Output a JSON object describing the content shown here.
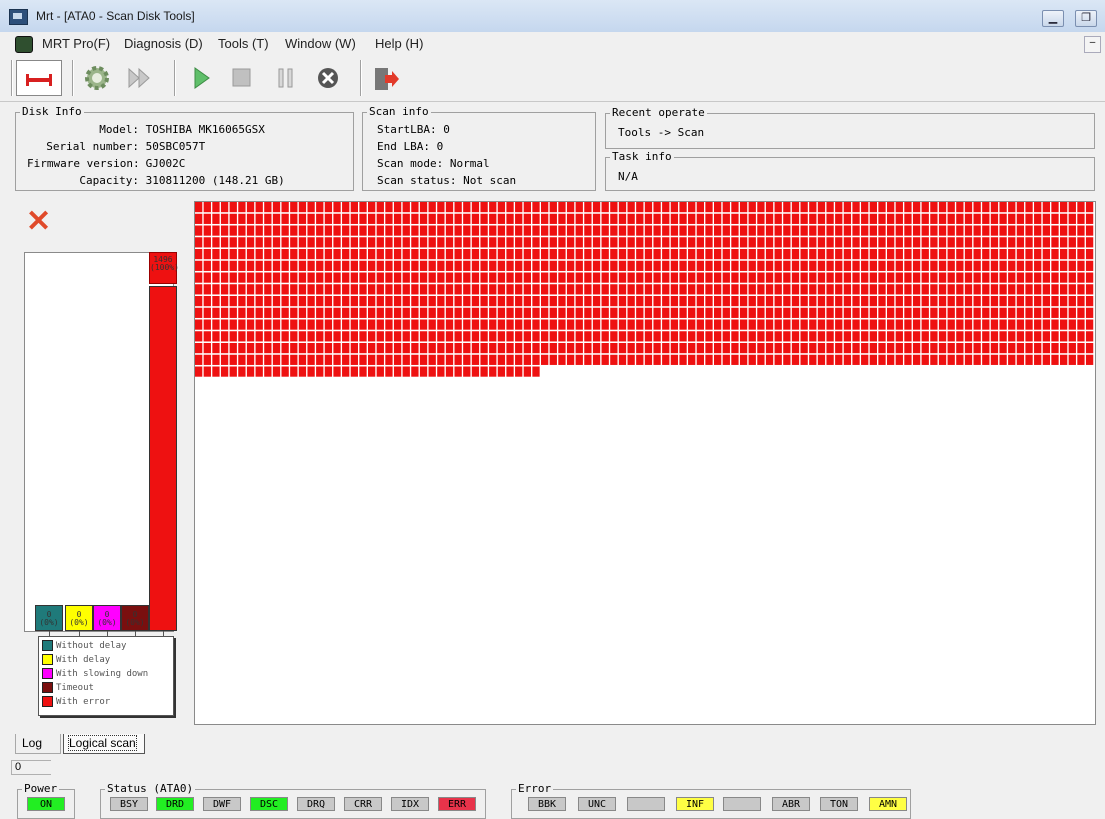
{
  "window": {
    "title": "Mrt - [ATA0 - Scan Disk Tools]"
  },
  "menu": {
    "items": [
      "MRT Pro(F)",
      "Diagnosis (D)",
      "Tools (T)",
      "Window (W)",
      "Help (H)"
    ]
  },
  "toolbar": {
    "buttons": [
      "disk-icon",
      "gear-icon",
      "fast-forward-icon",
      "play-icon",
      "stop-icon",
      "pause-icon",
      "cancel-icon",
      "exit-icon"
    ]
  },
  "disk_info": {
    "title": "Disk Info",
    "rows": [
      {
        "label": "Model:",
        "value": "TOSHIBA MK16065GSX"
      },
      {
        "label": "Serial number:",
        "value": "50SBC057T"
      },
      {
        "label": "Firmware version:",
        "value": "GJ002C"
      },
      {
        "label": "Capacity:",
        "value": "310811200 (148.21 GB)"
      }
    ]
  },
  "scan_info": {
    "title": "Scan info",
    "rows": [
      "StartLBA: 0",
      "End LBA: 0",
      "Scan mode: Normal",
      "Scan status: Not scan"
    ]
  },
  "recent_operate": {
    "title": "Recent operate",
    "value": "Tools -> Scan"
  },
  "task_info": {
    "title": "Task info",
    "value": "N/A"
  },
  "chart_data": {
    "type": "bar",
    "categories": [
      "Without delay",
      "With delay",
      "With slowing down",
      "Timeout",
      "With error"
    ],
    "values": [
      0,
      0,
      0,
      0,
      1496
    ],
    "labels": [
      "0\n(0%)",
      "0\n(0%)",
      "0\n(0%)",
      "0\n(0%)",
      "1496\n(100%)"
    ],
    "colors": [
      "#1f7a7a",
      "#ffff00",
      "#ff00ff",
      "#7a0f0f",
      "#ee1111"
    ]
  },
  "legend": {
    "items": [
      {
        "label": "Without delay",
        "color": "#1f7a7a"
      },
      {
        "label": "With delay",
        "color": "#ffff00"
      },
      {
        "label": "With slowing down",
        "color": "#ff00ff"
      },
      {
        "label": "Timeout",
        "color": "#7a0f0f"
      },
      {
        "label": "With error",
        "color": "#ee1111"
      }
    ]
  },
  "scan_grid": {
    "error_blocks": 1496,
    "error_color": "#ee1111"
  },
  "tabs": [
    "Log",
    "Logical scan"
  ],
  "status_box": "0",
  "indicators": {
    "power": {
      "title": "Power",
      "items": [
        {
          "label": "ON",
          "color": "#22ee22"
        }
      ]
    },
    "status": {
      "title": "Status (ATA0)",
      "items": [
        {
          "label": "BSY",
          "color": "#c8c8c8"
        },
        {
          "label": "DRD",
          "color": "#22ee22"
        },
        {
          "label": "DWF",
          "color": "#c8c8c8"
        },
        {
          "label": "DSC",
          "color": "#22ee22"
        },
        {
          "label": "DRQ",
          "color": "#c8c8c8"
        },
        {
          "label": "CRR",
          "color": "#c8c8c8"
        },
        {
          "label": "IDX",
          "color": "#c8c8c8"
        },
        {
          "label": "ERR",
          "color": "#e8334a"
        }
      ]
    },
    "error": {
      "title": "Error",
      "items": [
        {
          "label": "BBK",
          "color": "#c8c8c8"
        },
        {
          "label": "UNC",
          "color": "#c8c8c8"
        },
        {
          "label": "",
          "color": "#c8c8c8"
        },
        {
          "label": "INF",
          "color": "#ffff44"
        },
        {
          "label": "",
          "color": "#c8c8c8"
        },
        {
          "label": "ABR",
          "color": "#c8c8c8"
        },
        {
          "label": "TON",
          "color": "#c8c8c8"
        },
        {
          "label": "AMN",
          "color": "#ffff44"
        }
      ]
    }
  }
}
